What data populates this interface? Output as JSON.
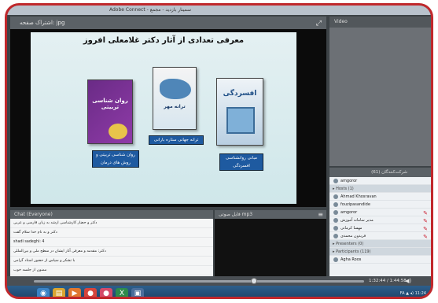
{
  "window": {
    "title": "Adobe Connect - سمینار بازدید - مجمع"
  },
  "share": {
    "header": "اشتراک صفحه: jpg",
    "fullscreen_icon": "expand-icon"
  },
  "slide": {
    "title": "معرفی تعدادی از آثار دکتر غلامعلی افروز",
    "books": [
      {
        "title": "روان شناسی تربیتی",
        "caption": "روان شناسی تربیتی و روش های درمان"
      },
      {
        "title": "ترانه مهر",
        "caption": "ترانه جهانی ستاره بارانی"
      },
      {
        "title": "افسردگی",
        "caption": "مبانی روانشناسی افسردگی"
      }
    ]
  },
  "video": {
    "header": "Video"
  },
  "attendees": {
    "header": "شرکت‌کنندگان (61)",
    "rows": [
      {
        "type": "user",
        "name": "amgoror"
      },
      {
        "type": "group",
        "name": "Hosts (1)"
      },
      {
        "type": "user",
        "name": "Ahmad Khosravan"
      },
      {
        "type": "user",
        "name": "fouzipasandide"
      },
      {
        "type": "user",
        "name": "amgoror",
        "mark": "✎"
      },
      {
        "type": "user",
        "name": "مدیر سامانه آموزش",
        "mark": "✎"
      },
      {
        "type": "user",
        "name": "مهسا کرمانی",
        "mark": "✎"
      },
      {
        "type": "user",
        "name": "فریدون محمدی",
        "mark": "✎"
      },
      {
        "type": "group",
        "name": "Presenters (0)"
      },
      {
        "type": "group",
        "name": "Participants (119)"
      },
      {
        "type": "user",
        "name": "Agha Roos"
      }
    ]
  },
  "chat": {
    "header": "Chat (Everyone)",
    "messages": [
      "دکتر و حضار کارشناسی ارشد به زبان فارسی و عربی",
      "دکتر و به نام خدا سلام گفت",
      "shadi sadeghi: 4",
      "دکتر: مقدمه و معرفی آثار ایشان در سطح ملی و بین‌المللی",
      "با تشکر و سپاس از حضور استاد گرامی",
      "ممنون از جلسه خوب"
    ]
  },
  "file": {
    "header": "فایل صوتی mp3",
    "menu_icon": "menu-icon"
  },
  "player": {
    "time": "1:32:44 / 1:44:58",
    "volume_icon": "volume-icon"
  },
  "taskbar": {
    "items": [
      {
        "icon": "start-icon",
        "glyph": "◉",
        "color": "#3a83c6"
      },
      {
        "icon": "folder-icon",
        "glyph": "▤",
        "color": "#d9a531"
      },
      {
        "icon": "media-icon",
        "glyph": "▶",
        "color": "#e0772f"
      },
      {
        "icon": "chrome-icon",
        "glyph": "●",
        "color": "#d6453c"
      },
      {
        "icon": "app-icon",
        "glyph": "●",
        "color": "#d34b6a"
      },
      {
        "icon": "excel-icon",
        "glyph": "X",
        "color": "#2d8a4c"
      },
      {
        "icon": "connect-icon",
        "glyph": "▣",
        "color": "#4a6e9b"
      }
    ],
    "tray": "FA  ▲  ◂)  11:24"
  }
}
